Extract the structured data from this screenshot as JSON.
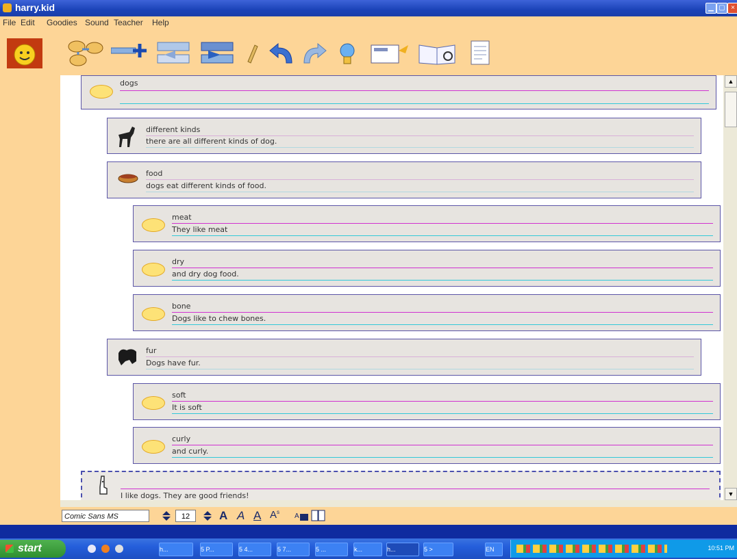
{
  "window": {
    "title": "harry.kid"
  },
  "menu": [
    "File",
    "Edit",
    "Goodies",
    "Sound",
    "Teacher",
    "Help"
  ],
  "toolbar": {
    "icons": [
      "kidspiration-face-icon",
      "add-bubble-icon",
      "add-subtopic-icon",
      "move-left-icon",
      "move-right-icon",
      "pencil-icon",
      "undo-icon",
      "redo-icon",
      "light-bulb-icon",
      "notes-icon",
      "book-icon",
      "document-icon"
    ]
  },
  "outline": {
    "nodes": [
      {
        "title": "dogs",
        "text": "",
        "icon": "oval-bullet-icon"
      },
      {
        "title": "different kinds",
        "text": "there are all different kinds of dog.",
        "icon": "dog-icon"
      },
      {
        "title": "food",
        "text": "dogs eat different kinds of food.",
        "icon": "hotdog-icon"
      },
      {
        "title": "meat",
        "text": "They like meat",
        "icon": "oval-bullet-icon"
      },
      {
        "title": "dry",
        "text": "and dry dog food.",
        "icon": "oval-bullet-icon"
      },
      {
        "title": "bone",
        "text": "Dogs like to chew bones.",
        "icon": "oval-bullet-icon"
      },
      {
        "title": "fur",
        "text": "Dogs have fur.",
        "icon": "fur-icon"
      },
      {
        "title": "soft",
        "text": "It is soft",
        "icon": "oval-bullet-icon"
      },
      {
        "title": "curly",
        "text": "and curly.",
        "icon": "oval-bullet-icon"
      },
      {
        "title": "",
        "text": "I like dogs. They are good friends!",
        "icon": "giraffe-icon"
      }
    ]
  },
  "format_bar": {
    "font": "Comic Sans MS",
    "size": "12",
    "buttons": [
      "bold-icon",
      "italic-icon",
      "underline-icon",
      "superscript-icon",
      "text-color-icon",
      "columns-icon"
    ]
  },
  "taskbar": {
    "start_label": "start",
    "tasks": [
      "h...",
      "5 P...",
      "5 4...",
      "5 7...",
      "5 ...",
      "k...",
      "h...",
      "5 >",
      "EN"
    ],
    "clock": "10:51 PM"
  },
  "colors": {
    "accent_orange": "#fdd597",
    "node_border": "#5a54a6",
    "line_pink": "#d030d0",
    "line_cyan": "#30c8d8"
  }
}
